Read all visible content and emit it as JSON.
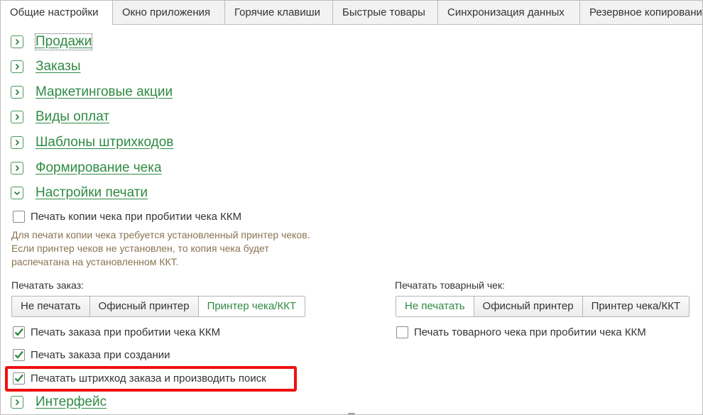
{
  "tabs": [
    {
      "label": "Общие настройки",
      "active": true
    },
    {
      "label": "Окно приложения",
      "active": false
    },
    {
      "label": "Горячие клавиши",
      "active": false
    },
    {
      "label": "Быстрые товары",
      "active": false
    },
    {
      "label": "Синхронизация данных",
      "active": false
    },
    {
      "label": "Резервное копирование",
      "active": false
    }
  ],
  "groups": [
    {
      "label": "Продажи",
      "state": "collapsed"
    },
    {
      "label": "Заказы",
      "state": "collapsed"
    },
    {
      "label": "Маркетинговые акции",
      "state": "collapsed"
    },
    {
      "label": "Виды оплат",
      "state": "collapsed"
    },
    {
      "label": "Шаблоны штрихкодов",
      "state": "collapsed"
    },
    {
      "label": "Формирование чека",
      "state": "collapsed"
    },
    {
      "label": "Настройки печати",
      "state": "expanded"
    },
    {
      "label": "Интерфейс",
      "state": "collapsed"
    }
  ],
  "print_settings": {
    "copy_checkbox": {
      "label": "Печать копии чека при пробитии чека ККМ",
      "checked": false
    },
    "note_lines": [
      "Для печати копии чека требуется установленный принтер чеков.",
      "Если принтер чеков не установлен, то копия чека будет",
      "распечатана на установленном ККТ."
    ],
    "print_order": {
      "label": "Печатать заказ:",
      "options": [
        "Не печатать",
        "Офисный принтер",
        "Принтер чека/ККТ"
      ],
      "selected": "Принтер чека/ККТ"
    },
    "print_goods_receipt": {
      "label": "Печатать товарный чек:",
      "options": [
        "Не печатать",
        "Офисный принтер",
        "Принтер чека/ККТ"
      ],
      "selected": "Не печатать"
    },
    "checkboxes_left": [
      {
        "label": "Печать заказа при пробитии чека ККМ",
        "checked": true
      },
      {
        "label": "Печать заказа при создании",
        "checked": true
      },
      {
        "label": "Печатать штрихкод заказа и производить поиск",
        "checked": true,
        "highlighted": true
      }
    ],
    "checkbox_right": {
      "label": "Печать товарного чека при пробитии чека ККМ",
      "checked": false
    }
  },
  "colors": {
    "group_link": "#2f8a43",
    "note_text": "#8a7350",
    "highlight_border": "#ee1111",
    "check_mark": "#2f8a43"
  }
}
